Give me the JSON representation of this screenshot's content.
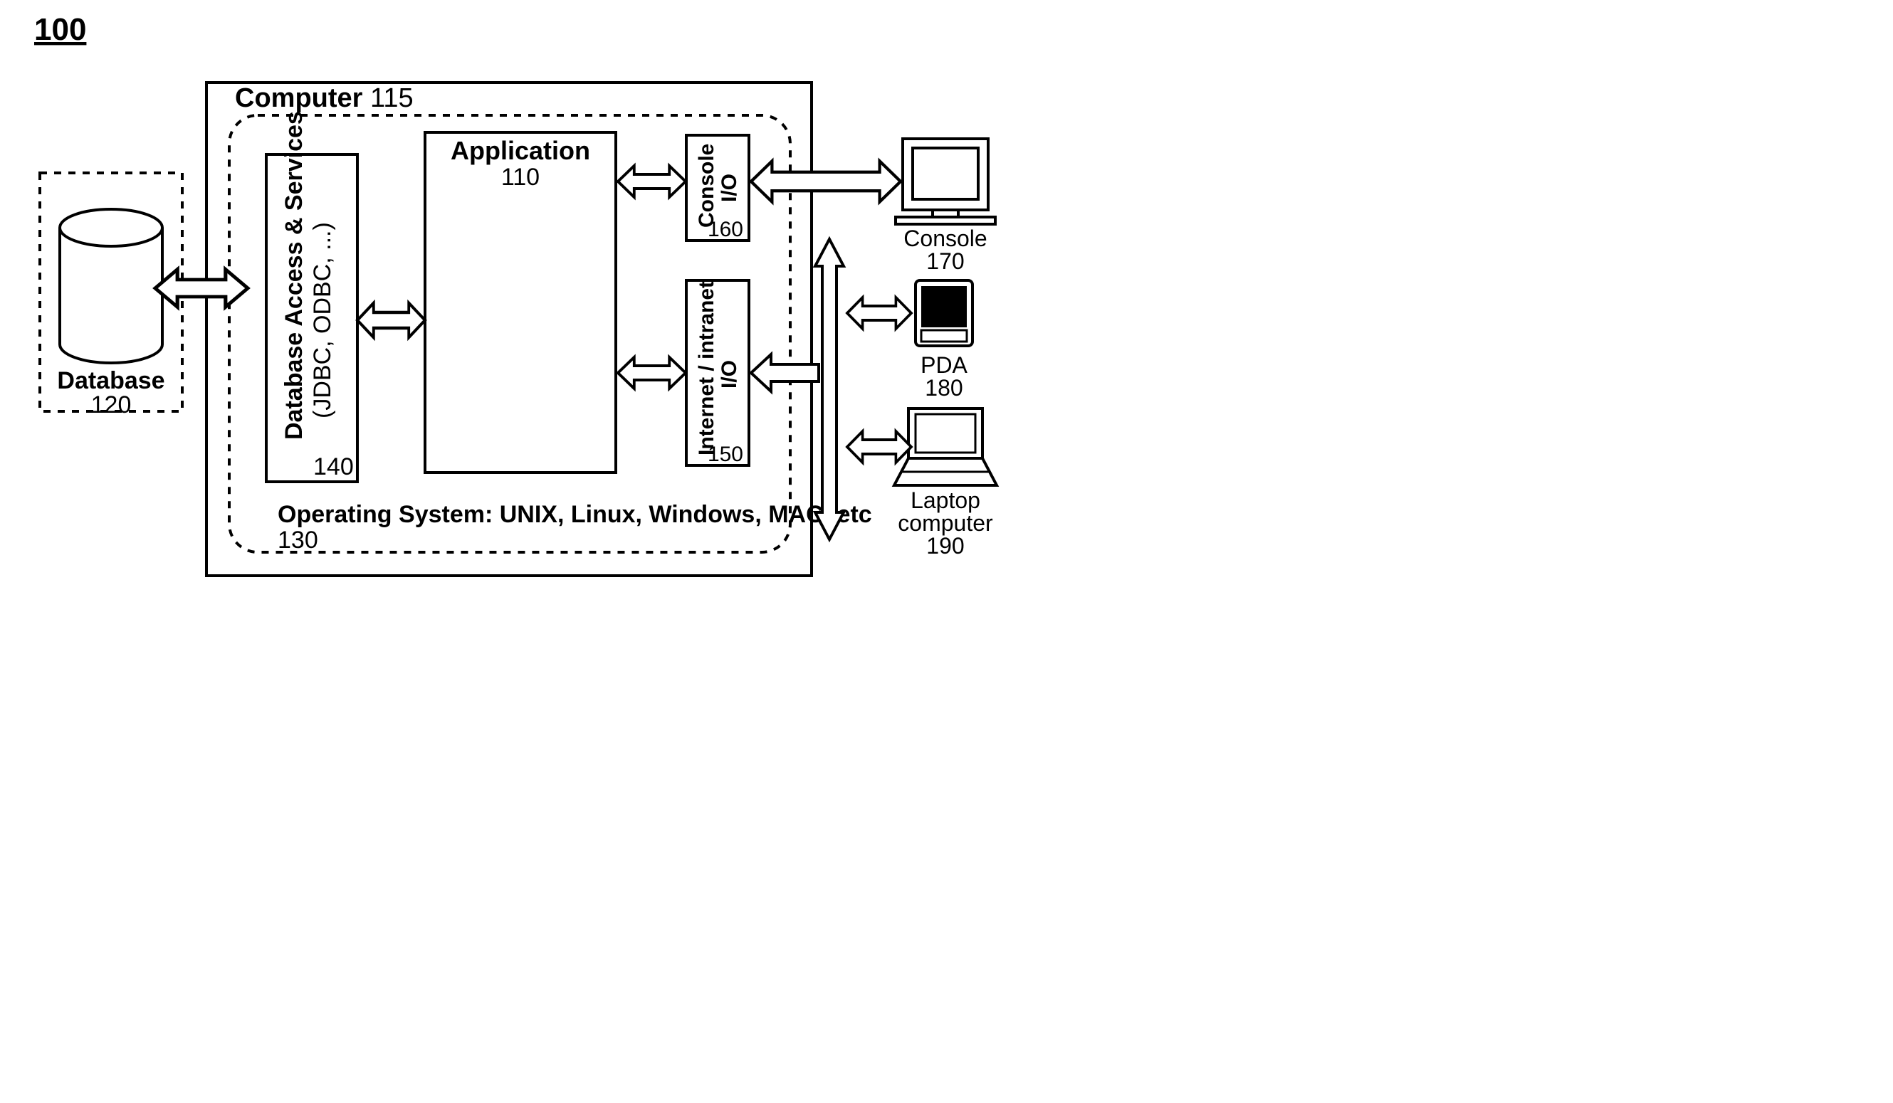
{
  "figure_ref": "100",
  "computer": {
    "title_bold": "Computer",
    "title_num": "115"
  },
  "os": {
    "line_bold": "Operating System: UNIX, Linux, Windows, MAC, etc",
    "num": "130"
  },
  "db_access": {
    "line1_bold": "Database Access & Services",
    "line2": "(JDBC, ODBC, ...)",
    "num": "140"
  },
  "application": {
    "title_bold": "Application",
    "num": "110"
  },
  "console_io": {
    "title_bold": "Console",
    "sub_bold": "I/O",
    "num": "160"
  },
  "internet_io": {
    "title_bold": "Internet / intranet",
    "sub_bold": "I/O",
    "num": "150"
  },
  "database": {
    "title_bold": "Database",
    "num": "120"
  },
  "console": {
    "label": "Console",
    "num": "170"
  },
  "pda": {
    "label": "PDA",
    "num": "180"
  },
  "laptop": {
    "label1": "Laptop",
    "label2": "computer",
    "num": "190"
  }
}
